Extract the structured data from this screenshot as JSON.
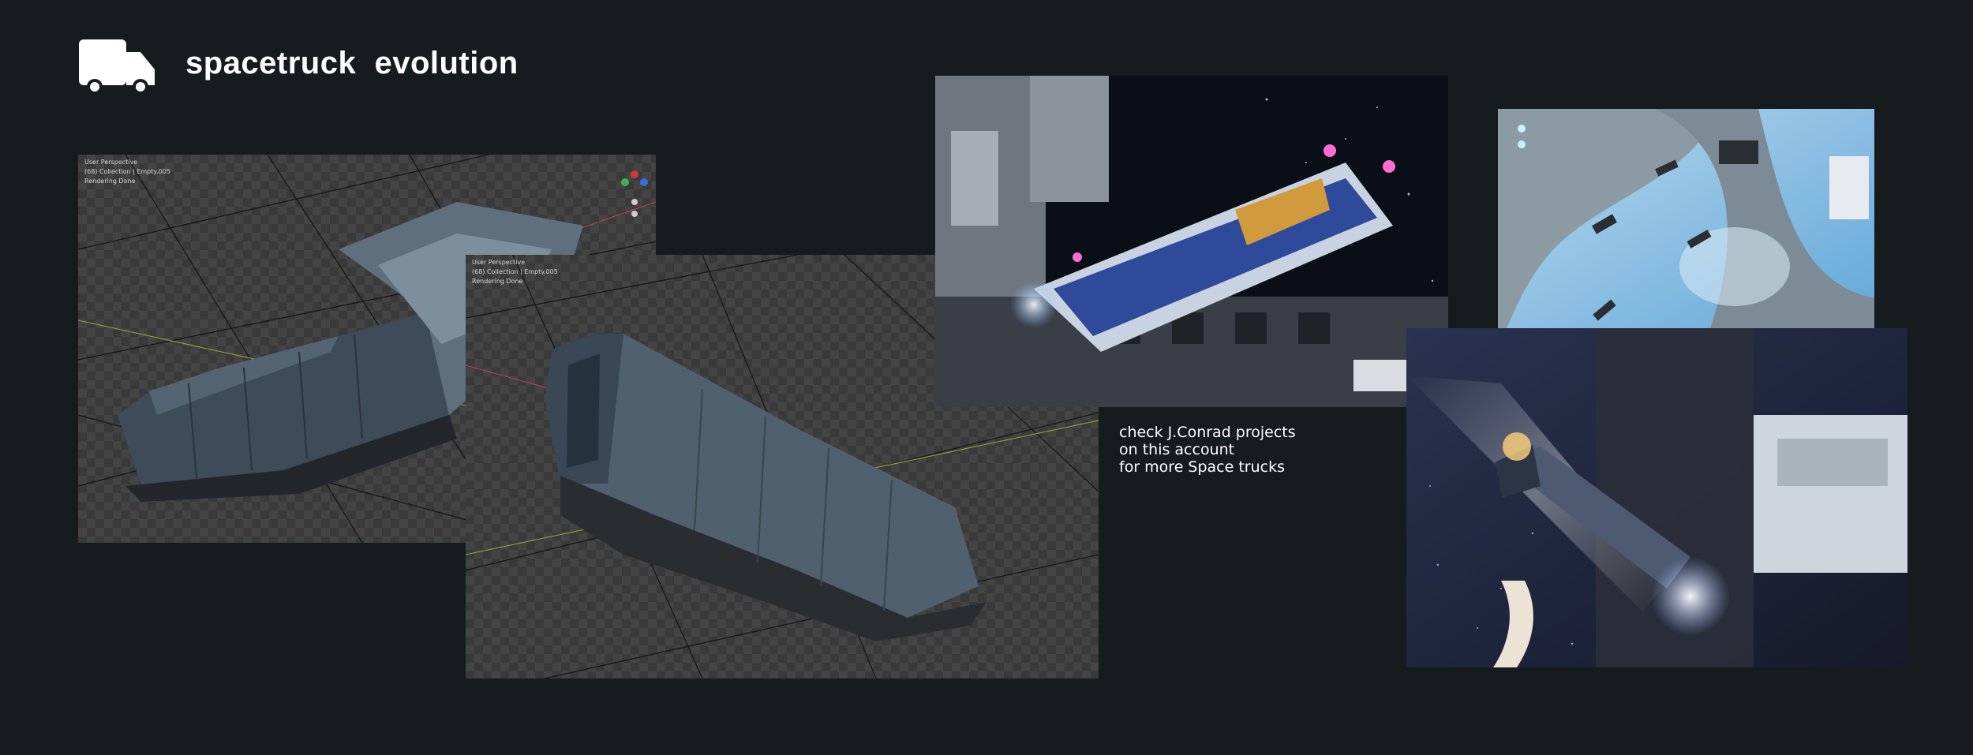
{
  "header": {
    "title": "spacetruck  evolution",
    "icon": "truck-icon"
  },
  "viewport_back": {
    "overlay": [
      "User Perspective",
      "(68) Collection | Empty.005",
      "Rendering Done"
    ]
  },
  "viewport_front": {
    "overlay": [
      "User Perspective",
      "(68) Collection | Empty.005",
      "Rendering Done"
    ]
  },
  "promo": {
    "lines": [
      "check J.Conrad projects",
      "on this account",
      "for more Space trucks"
    ]
  },
  "colors": {
    "background": "#161b1e",
    "text": "#ffffff",
    "neon_pink": "#ff6ad5",
    "sky_blue": "#6fb6e6"
  }
}
